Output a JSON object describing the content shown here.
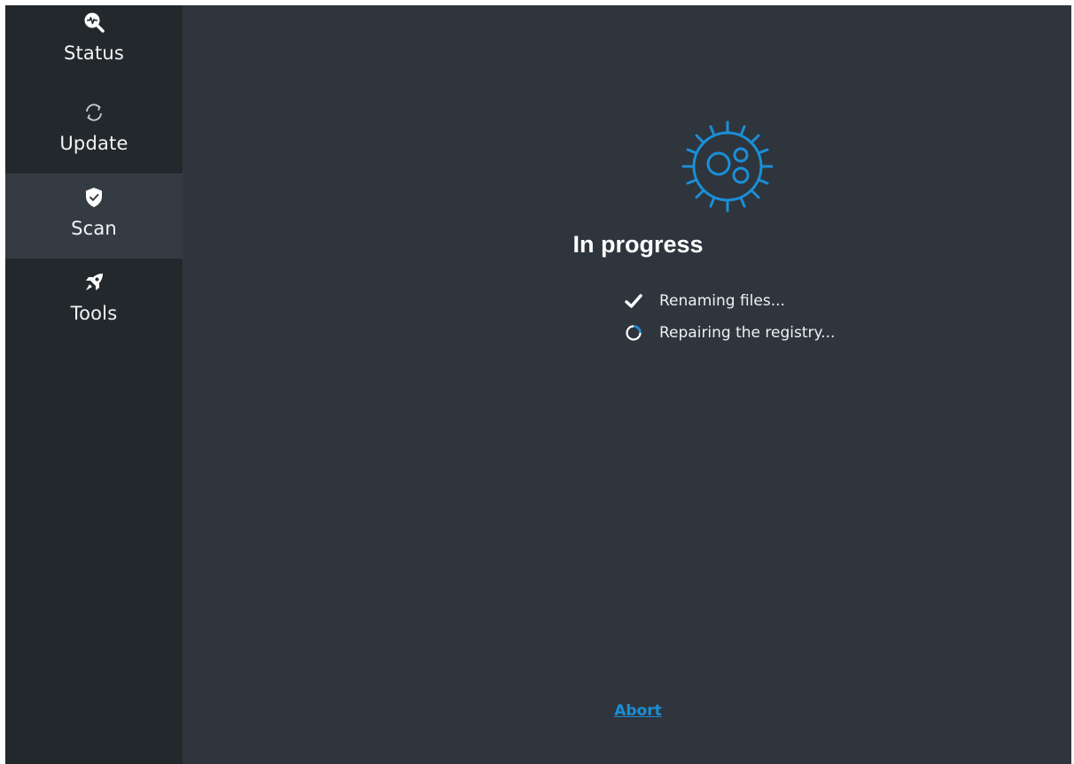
{
  "sidebar": {
    "items": [
      {
        "label": "Status",
        "icon": "status-magnifier-icon",
        "active": false
      },
      {
        "label": "Update",
        "icon": "update-sync-icon",
        "active": false
      },
      {
        "label": "Scan",
        "icon": "shield-check-icon",
        "active": true
      },
      {
        "label": "Tools",
        "icon": "rocket-icon",
        "active": false
      }
    ]
  },
  "main": {
    "illustration_icon": "virus-icon",
    "heading": "In progress",
    "steps": [
      {
        "label": "Renaming files...",
        "state": "done",
        "icon": "checkmark-icon"
      },
      {
        "label": "Repairing the registry...",
        "state": "running",
        "icon": "spinner-icon"
      }
    ],
    "abort_label": "Abort"
  },
  "colors": {
    "sidebar_bg": "#23282c",
    "sidebar_active_bg": "#343b43",
    "main_bg": "#2f353d",
    "accent_blue": "#1a8fd8",
    "text": "#ffffff"
  }
}
